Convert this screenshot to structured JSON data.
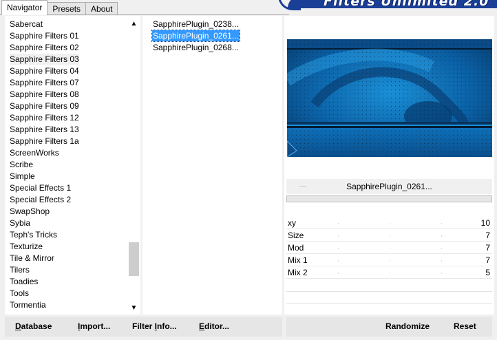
{
  "tabs": {
    "navigator": "Navigator",
    "presets": "Presets",
    "about": "About"
  },
  "banner": {
    "text": "Filters Unlimited 2.0"
  },
  "categories": [
    "Sabercat",
    "Sapphire Filters 01",
    "Sapphire Filters 02",
    "Sapphire Filters 03",
    "Sapphire Filters 04",
    "Sapphire Filters 07",
    "Sapphire Filters 08",
    "Sapphire Filters 09",
    "Sapphire Filters 12",
    "Sapphire Filters 13",
    "Sapphire Filters 1a",
    "ScreenWorks",
    "Scribe",
    "Simple",
    "Special Effects 1",
    "Special Effects 2",
    "SwapShop",
    "Sybia",
    "Teph's Tricks",
    "Texturize",
    "Tile & Mirror",
    "Tilers",
    "Toadies",
    "Tools",
    "Tormentia"
  ],
  "selected_category": "Sapphire Filters 03",
  "filters": [
    "SapphirePlugin_0238...",
    "SapphirePlugin_0261...",
    "SapphirePlugin_0268..."
  ],
  "selected_filter": "SapphirePlugin_0261...",
  "filter_name": "SapphirePlugin_0261...",
  "params": [
    {
      "label": "xy",
      "value": "10"
    },
    {
      "label": "Size",
      "value": "7"
    },
    {
      "label": "Mod",
      "value": "7"
    },
    {
      "label": "Mix 1",
      "value": "7"
    },
    {
      "label": "Mix 2",
      "value": "5"
    }
  ],
  "buttons": {
    "database": "Database",
    "import": "Import...",
    "filter_info": "Filter Info...",
    "editor": "Editor...",
    "randomize": "Randomize",
    "reset": "Reset"
  },
  "colors": {
    "selection": "#3399ff",
    "banner": "#1a3f96",
    "preview_base": "#0a5a9c"
  }
}
